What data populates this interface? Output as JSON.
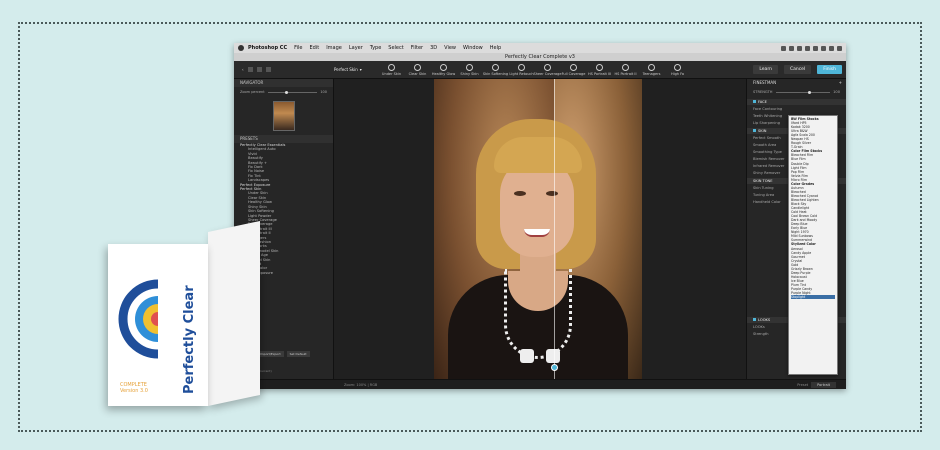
{
  "menubar": {
    "app": "Photoshop CC",
    "items": [
      "File",
      "Edit",
      "Image",
      "Layer",
      "Type",
      "Select",
      "Filter",
      "3D",
      "View",
      "Window",
      "Help"
    ]
  },
  "window": {
    "title": "Perfectly Clear Complete v3"
  },
  "toolbar": {
    "preset": "Perfect Skin",
    "tools": [
      "Under Skin",
      "Clear Skin",
      "Healthy Glow",
      "Shiny Skin",
      "Skin Softening",
      "Light Retouch",
      "Sheer Coverage",
      "Full Coverage",
      "HS Portrait III",
      "HS Portrait II",
      "Teenagers",
      "High Fa"
    ],
    "learn": "Learn",
    "cancel": "Cancel",
    "finish": "Finish"
  },
  "left_panel": {
    "navigator": "NAVIGATOR",
    "zoom_label": "Zoom percent",
    "zoom_value": "100",
    "presets_header": "PRESETS",
    "groups": [
      {
        "name": "Perfectly Clear Essentials",
        "items": [
          "Intelligent Auto",
          "Vivid",
          "Beautify",
          "Beautify +",
          "Fix Dark",
          "Fix Noise",
          "Fix Tint",
          "Landscapes"
        ]
      },
      {
        "name": "Perfect Exposure",
        "items": []
      },
      {
        "name": "Perfect Skin",
        "items": [
          "Under Skin",
          "Clear Skin",
          "Healthy Glow",
          "Shiny Skin",
          "Skin Softening",
          "Light Powder",
          "Sheer Coverage",
          "Full Coverage",
          "HS Portrait III",
          "HS Portrait II",
          "Teenagers",
          "High Fashion",
          "The Works",
          "Supermodel Skin",
          "Middle Age",
          "Rugged Skin",
          "Portrait",
          "Dark Color",
          "Fast Exposure"
        ]
      }
    ],
    "buttons": [
      "Delete",
      "Import/Export",
      "Set Default"
    ],
    "add_label": "+ Add to self (current)"
  },
  "right_panel": {
    "header": "FINESTMAN",
    "strength_label": "STRENGTH",
    "strength_value": "100",
    "sections": [
      {
        "name": "FACE",
        "rows": [
          "Face Contouring",
          "Teeth Whitening",
          "Lip Sharpening"
        ]
      },
      {
        "name": "SKIN",
        "rows": [
          "Perfect Smooth",
          "Smooth Area",
          "Smoothing Type",
          "Blemish Remover",
          "Infrared Remover",
          "Shiny Remover"
        ]
      },
      {
        "name": "SKIN TONE",
        "rows": [
          "Skin Tuning",
          "Tuning Area",
          "Handheld Color"
        ]
      },
      {
        "name": "LOOKS",
        "rows": [
          "LOOKs",
          "Strength"
        ]
      }
    ]
  },
  "dropdown": {
    "groups": [
      {
        "name": "BW Film Stocks",
        "items": [
          "Ilford HP5",
          "Kodak 3200",
          "Ultra B&W",
          "Agfa Scala 200",
          "Neopan HS",
          "Rough Silver",
          "T-Grain"
        ]
      },
      {
        "name": "Color Film Stocks",
        "items": [
          "Bleached Film",
          "Blue Film",
          "Double Dip",
          "Light Film",
          "Pop Film",
          "Velvia Film",
          "Micro Film"
        ]
      },
      {
        "name": "Color Grades",
        "items": [
          "Autumn",
          "Bleached",
          "Bleached Cyanot",
          "Bleached Lighten",
          "Black Sky",
          "Candlelight",
          "Cold Heat",
          "Cool Brown Cold",
          "Dark and Moody",
          "Deep Blue",
          "Early Blue",
          "Night 1970",
          "Mild Sunbows",
          "Summerwind"
        ]
      },
      {
        "name": "Stylized Color",
        "items": [
          "Aerosol",
          "Candy Apple",
          "Gourmet",
          "Crystal",
          "Gold",
          "Grizzly Brown",
          "Deep Purple",
          "Holocaust",
          "Ice Blue",
          "Plum Tint",
          "Purple Candy",
          "Purple Night",
          "Stoplight"
        ]
      }
    ],
    "selected": "Stoplight"
  },
  "statusbar": {
    "left": "Zoom: 100% | RGB",
    "preset_label": "Preset",
    "preset_value": "Portrait"
  },
  "product_box": {
    "brand": "Perfectly Clear",
    "complete": "COMPLETE",
    "version": "Version 3.0"
  }
}
